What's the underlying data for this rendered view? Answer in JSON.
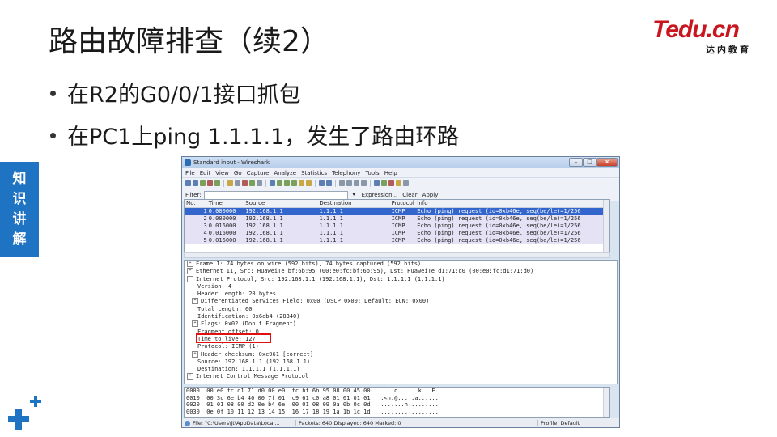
{
  "slide": {
    "title": "路由故障排查（续2）",
    "bullets": [
      "在R2的G0/0/1接口抓包",
      "在PC1上ping 1.1.1.1，发生了路由环路"
    ],
    "side_tab": [
      "知",
      "识",
      "讲",
      "解"
    ],
    "logo_main": "Tedu.cn",
    "logo_sub": "达内教育"
  },
  "colors": {
    "accent_blue": "#1e73c2",
    "logo_red": "#c9151e",
    "highlight_red": "#e01010",
    "selected_row": "#3366cc"
  },
  "wireshark": {
    "window_title": "Standard input - Wireshark",
    "menu": [
      "File",
      "Edit",
      "View",
      "Go",
      "Capture",
      "Analyze",
      "Statistics",
      "Telephony",
      "Tools",
      "Help"
    ],
    "filter_label": "Filter:",
    "filter_value": "",
    "expression_link": "Expression...",
    "clear_link": "Clear",
    "apply_link": "Apply",
    "columns": [
      "No.",
      "Time",
      "Source",
      "Destination",
      "Protocol",
      "Info"
    ],
    "packets": [
      {
        "no": "1",
        "time": "0.000000",
        "src": "192.168.1.1",
        "dst": "1.1.1.1",
        "proto": "ICMP",
        "info": "Echo (ping) request  (id=0xb46e, seq(be/le)=1/256"
      },
      {
        "no": "2",
        "time": "0.000000",
        "src": "192.168.1.1",
        "dst": "1.1.1.1",
        "proto": "ICMP",
        "info": "Echo (ping) request  (id=0xb46e, seq(be/le)=1/256"
      },
      {
        "no": "3",
        "time": "0.016000",
        "src": "192.168.1.1",
        "dst": "1.1.1.1",
        "proto": "ICMP",
        "info": "Echo (ping) request  (id=0xb46e, seq(be/le)=1/256"
      },
      {
        "no": "4",
        "time": "0.016000",
        "src": "192.168.1.1",
        "dst": "1.1.1.1",
        "proto": "ICMP",
        "info": "Echo (ping) request  (id=0xb46e, seq(be/le)=1/256"
      },
      {
        "no": "5",
        "time": "0.016000",
        "src": "192.168.1.1",
        "dst": "1.1.1.1",
        "proto": "ICMP",
        "info": "Echo (ping) request  (id=0xb46e, seq(be/le)=1/256"
      }
    ],
    "details": [
      "Frame 1: 74 bytes on wire (592 bits), 74 bytes captured (592 bits)",
      "Ethernet II, Src: HuaweiTe_bf:6b:95 (00:e0:fc:bf:6b:95), Dst: HuaweiTe_d1:71:d0 (00:e0:fc:d1:71:d0)",
      "Internet Protocol, Src: 192.168.1.1 (192.168.1.1), Dst: 1.1.1.1 (1.1.1.1)",
      "Version: 4",
      "Header length: 20 bytes",
      "Differentiated Services Field: 0x00 (DSCP 0x00: Default; ECN: 0x00)",
      "Total Length: 60",
      "Identification: 0x6eb4 (28340)",
      "Flags: 0x02 (Don't Fragment)",
      "Fragment offset: 0",
      "Time to live: 127",
      "Protocol: ICMP (1)",
      "Header checksum: 0xc961 [correct]",
      "Source: 192.168.1.1 (192.168.1.1)",
      "Destination: 1.1.1.1 (1.1.1.1)",
      "Internet Control Message Protocol"
    ],
    "hex": [
      "0000  00 e0 fc d1 71 d0 00 e0  fc bf 6b 95 08 00 45 00   ....q... ..k...E.",
      "0010  00 3c 6e b4 40 00 7f 01  c9 61 c0 a8 01 01 01 01   .<n.@... .a......",
      "0020  01 01 08 00 d2 0e b4 6e  00 01 08 09 0a 0b 0c 0d   .......n ........",
      "0030  0e 0f 10 11 12 13 14 15  16 17 18 19 1a 1b 1c 1d   ........ ........"
    ],
    "status_file": "File: \"C:\\Users\\jt\\AppData\\Local...",
    "status_packets": "Packets: 640 Displayed: 640 Marked: 0",
    "status_profile": "Profile: Default"
  }
}
